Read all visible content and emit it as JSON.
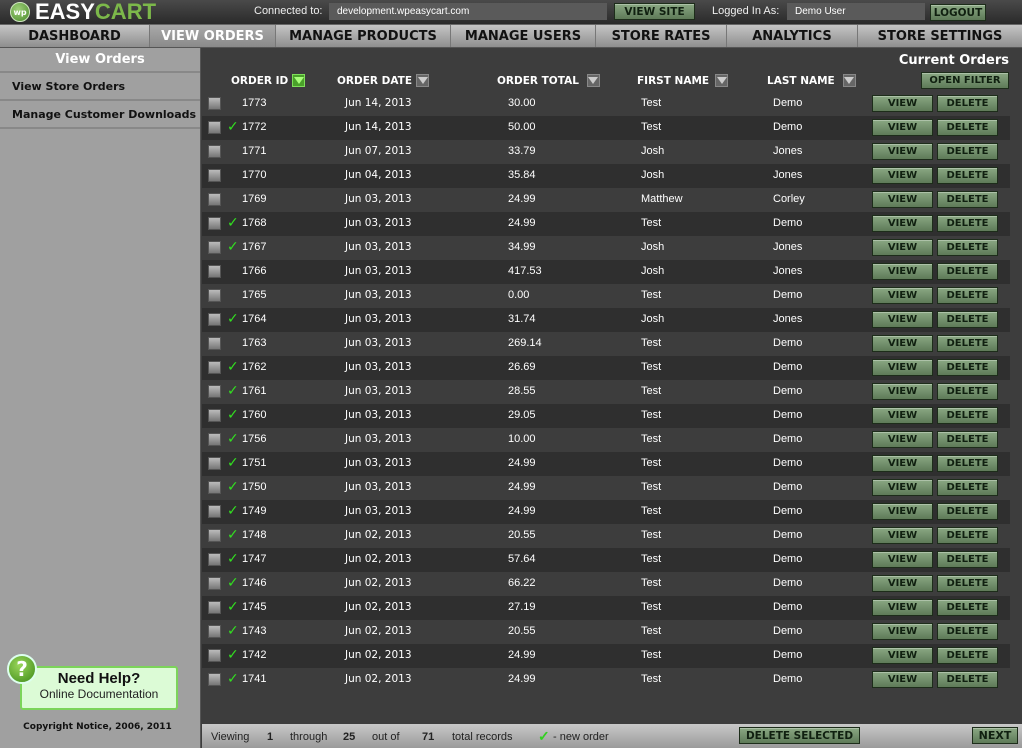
{
  "header": {
    "logo_easy": "EASY",
    "logo_cart": "CART",
    "logo_badge": "wp",
    "connected_label": "Connected to:",
    "connected_value": "development.wpeasycart.com",
    "view_site": "VIEW SITE",
    "logged_in_label": "Logged In As:",
    "logged_in_value": "Demo User",
    "logout": "LOGOUT"
  },
  "nav": {
    "items": [
      {
        "label": "DASHBOARD"
      },
      {
        "label": "VIEW ORDERS"
      },
      {
        "label": "MANAGE PRODUCTS"
      },
      {
        "label": "MANAGE USERS"
      },
      {
        "label": "STORE RATES"
      },
      {
        "label": "ANALYTICS"
      },
      {
        "label": "STORE SETTINGS"
      }
    ],
    "active": "VIEW ORDERS"
  },
  "sidebar": {
    "title": "View Orders",
    "items": [
      {
        "label": "View Store Orders"
      },
      {
        "label": "Manage Customer Downloads"
      }
    ],
    "help_title": "Need Help?",
    "help_sub": "Online Documentation",
    "help_icon": "?",
    "copyright": "Copyright  Notice, 2006, 2011"
  },
  "main": {
    "title": "Current Orders",
    "open_filter": "OPEN FILTER",
    "columns": [
      "ORDER ID",
      "ORDER DATE",
      "ORDER TOTAL",
      "FIRST NAME",
      "LAST NAME"
    ],
    "view_label": "VIEW",
    "delete_label": "DELETE",
    "new_mark": "✓",
    "rows": [
      {
        "id": "1773",
        "date": "Jun  14, 2013",
        "total": "30.00",
        "first": "Test",
        "last": "Demo",
        "new": false
      },
      {
        "id": "1772",
        "date": "Jun  14, 2013",
        "total": "50.00",
        "first": "Test",
        "last": "Demo",
        "new": true
      },
      {
        "id": "1771",
        "date": "Jun  07, 2013",
        "total": "33.79",
        "first": "Josh",
        "last": "Jones",
        "new": false
      },
      {
        "id": "1770",
        "date": "Jun  04, 2013",
        "total": "35.84",
        "first": "Josh",
        "last": "Jones",
        "new": false
      },
      {
        "id": "1769",
        "date": "Jun  03, 2013",
        "total": "24.99",
        "first": "Matthew",
        "last": "Corley",
        "new": false
      },
      {
        "id": "1768",
        "date": "Jun  03, 2013",
        "total": "24.99",
        "first": "Test",
        "last": "Demo",
        "new": true
      },
      {
        "id": "1767",
        "date": "Jun  03, 2013",
        "total": "34.99",
        "first": "Josh",
        "last": "Jones",
        "new": true
      },
      {
        "id": "1766",
        "date": "Jun  03, 2013",
        "total": "417.53",
        "first": "Josh",
        "last": "Jones",
        "new": false
      },
      {
        "id": "1765",
        "date": "Jun  03, 2013",
        "total": "0.00",
        "first": "Test",
        "last": "Demo",
        "new": false
      },
      {
        "id": "1764",
        "date": "Jun  03, 2013",
        "total": "31.74",
        "first": "Josh",
        "last": "Jones",
        "new": true
      },
      {
        "id": "1763",
        "date": "Jun  03, 2013",
        "total": "269.14",
        "first": "Test",
        "last": "Demo",
        "new": false
      },
      {
        "id": "1762",
        "date": "Jun  03, 2013",
        "total": "26.69",
        "first": "Test",
        "last": "Demo",
        "new": true
      },
      {
        "id": "1761",
        "date": "Jun  03, 2013",
        "total": "28.55",
        "first": "Test",
        "last": "Demo",
        "new": true
      },
      {
        "id": "1760",
        "date": "Jun  03, 2013",
        "total": "29.05",
        "first": "Test",
        "last": "Demo",
        "new": true
      },
      {
        "id": "1756",
        "date": "Jun  03, 2013",
        "total": "10.00",
        "first": "Test",
        "last": "Demo",
        "new": true
      },
      {
        "id": "1751",
        "date": "Jun  03, 2013",
        "total": "24.99",
        "first": "Test",
        "last": "Demo",
        "new": true
      },
      {
        "id": "1750",
        "date": "Jun  03, 2013",
        "total": "24.99",
        "first": "Test",
        "last": "Demo",
        "new": true
      },
      {
        "id": "1749",
        "date": "Jun  03, 2013",
        "total": "24.99",
        "first": "Test",
        "last": "Demo",
        "new": true
      },
      {
        "id": "1748",
        "date": "Jun  02, 2013",
        "total": "20.55",
        "first": "Test",
        "last": "Demo",
        "new": true
      },
      {
        "id": "1747",
        "date": "Jun  02, 2013",
        "total": "57.64",
        "first": "Test",
        "last": "Demo",
        "new": true
      },
      {
        "id": "1746",
        "date": "Jun  02, 2013",
        "total": "66.22",
        "first": "Test",
        "last": "Demo",
        "new": true
      },
      {
        "id": "1745",
        "date": "Jun  02, 2013",
        "total": "27.19",
        "first": "Test",
        "last": "Demo",
        "new": true
      },
      {
        "id": "1743",
        "date": "Jun  02, 2013",
        "total": "20.55",
        "first": "Test",
        "last": "Demo",
        "new": true
      },
      {
        "id": "1742",
        "date": "Jun  02, 2013",
        "total": "24.99",
        "first": "Test",
        "last": "Demo",
        "new": true
      },
      {
        "id": "1741",
        "date": "Jun  02, 2013",
        "total": "24.99",
        "first": "Test",
        "last": "Demo",
        "new": true
      }
    ]
  },
  "footer": {
    "viewing": "Viewing",
    "from": "1",
    "through": "through",
    "to": "25",
    "out_of": "out of",
    "total": "71",
    "total_records": "total records",
    "legend_mark": "✓",
    "legend_text": "- new order",
    "delete_selected": "DELETE SELECTED",
    "next": "NEXT"
  }
}
